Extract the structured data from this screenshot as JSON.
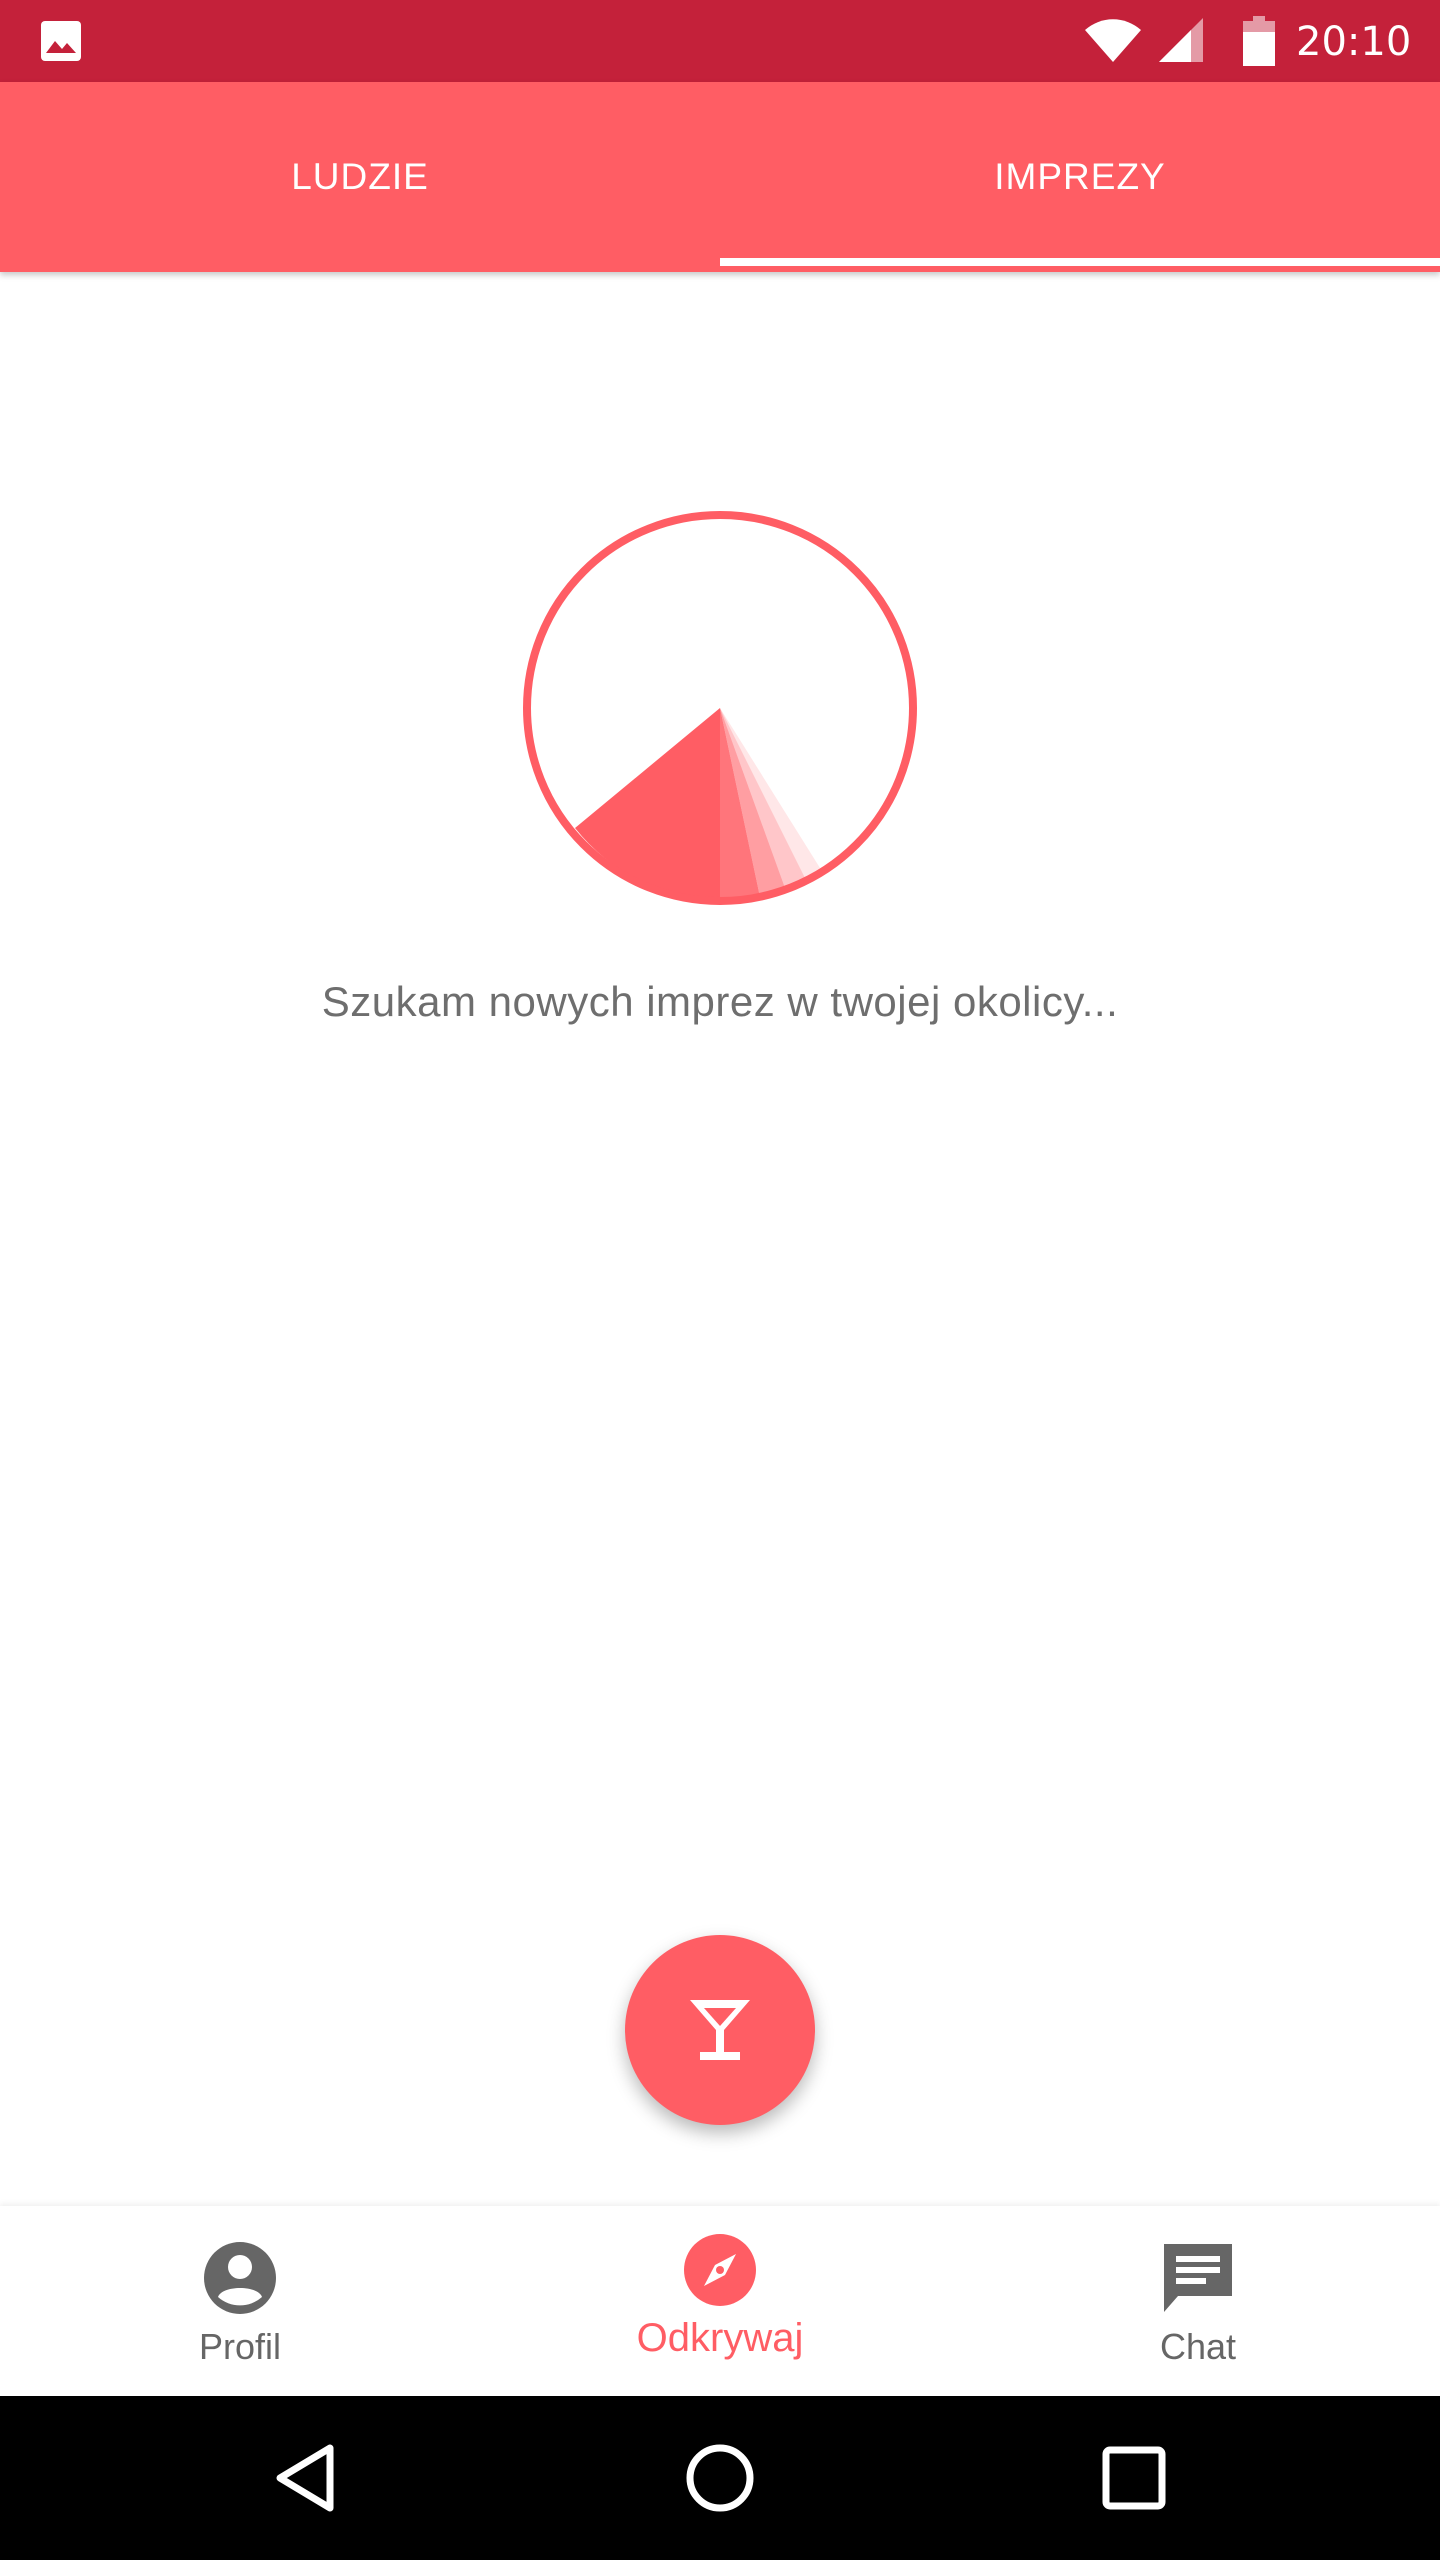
{
  "status_bar": {
    "time": "20:10",
    "icons": [
      "gallery-icon",
      "wifi-icon",
      "signal-icon",
      "battery-icon"
    ]
  },
  "tabs": {
    "items": [
      {
        "label": "LUDZIE",
        "selected": false
      },
      {
        "label": "IMPREZY",
        "selected": true
      }
    ]
  },
  "main": {
    "radar_icon": "radar-icon",
    "status_text": "Szukam nowych imprez w twojej okolicy..."
  },
  "fab": {
    "icon": "cocktail-icon"
  },
  "bottom_nav": {
    "items": [
      {
        "label": "Profil",
        "icon": "account-circle-icon",
        "selected": false
      },
      {
        "label": "Odkrywaj",
        "icon": "compass-icon",
        "selected": true
      },
      {
        "label": "Chat",
        "icon": "chat-icon",
        "selected": false
      }
    ]
  },
  "system_nav": {
    "icons": [
      "back-icon",
      "home-icon",
      "recents-icon"
    ]
  },
  "colors": {
    "accent": "#ff5d64",
    "status_bar": "#c4213a",
    "text_secondary": "#6e6e6e",
    "nav_inactive": "#666666"
  }
}
